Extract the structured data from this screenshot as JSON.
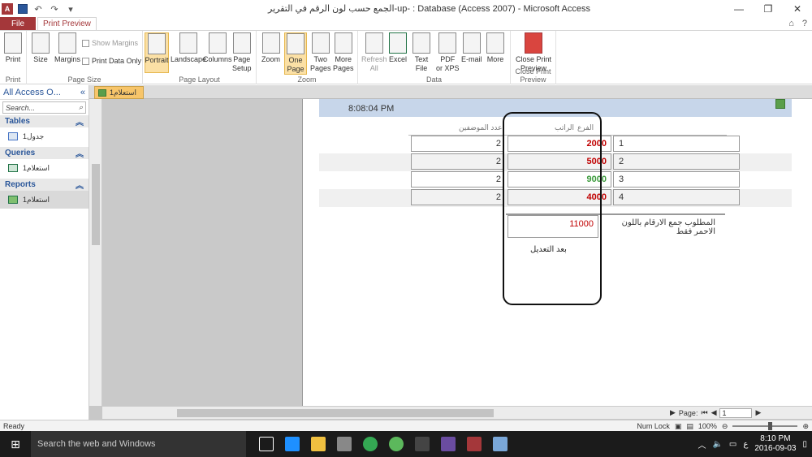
{
  "window": {
    "title": "الجمع حسب لون الرقم في التقرير-up- : Database (Access 2007) - Microsoft Access",
    "app_letter": "A",
    "help": "?"
  },
  "ribbon_tabs": {
    "file": "File",
    "active": "Print Preview"
  },
  "ribbon": {
    "groups": {
      "print": "Print",
      "page_size": "Page Size",
      "page_layout": "Page Layout",
      "zoom": "Zoom",
      "data": "Data",
      "close": "Close Print Preview"
    },
    "buttons": {
      "print": "Print",
      "size": "Size",
      "margins": "Margins",
      "show_margins": "Show Margins",
      "print_data_only": "Print Data Only",
      "portrait": "Portrait",
      "landscape": "Landscape",
      "columns": "Columns",
      "page_setup_1": "Page",
      "page_setup_2": "Setup",
      "zoom": "Zoom",
      "one_page_1": "One",
      "one_page_2": "Page",
      "two_pages_1": "Two",
      "two_pages_2": "Pages",
      "more_pages_1": "More",
      "more_pages_2": "Pages",
      "refresh_1": "Refresh",
      "refresh_2": "All",
      "excel": "Excel",
      "text_file_1": "Text",
      "text_file_2": "File",
      "pdf_1": "PDF",
      "pdf_2": "or XPS",
      "email": "E-mail",
      "more_1": "More",
      "close_1": "Close Print",
      "close_2": "Preview"
    }
  },
  "nav": {
    "header": "All Access O...",
    "search_placeholder": "Search...",
    "sections": [
      {
        "title": "Tables",
        "item": "جدول1"
      },
      {
        "title": "Queries",
        "item": "استعلام1"
      },
      {
        "title": "Reports",
        "item": "استعلام1"
      }
    ]
  },
  "doc_tab": {
    "label": "استعلام1"
  },
  "report": {
    "time": "8:08:04 PM",
    "headers": {
      "branch": "الفرع",
      "salary": "الراتب",
      "employees": "عدد الموضفين"
    },
    "rows": [
      {
        "branch": "1",
        "salary": "2000",
        "salary_color": "#c00000",
        "employees": "2"
      },
      {
        "branch": "2",
        "salary": "5000",
        "salary_color": "#c00000",
        "employees": "2"
      },
      {
        "branch": "3",
        "salary": "9000",
        "salary_color": "#3a9a3a",
        "employees": "2"
      },
      {
        "branch": "4",
        "salary": "4000",
        "salary_color": "#c00000",
        "employees": "2"
      }
    ],
    "sum_value": "11000",
    "sum_label": "المطلوب جمع الارقام باللون الاحمر فقط",
    "after_edit": "بعد التعديل"
  },
  "pager": {
    "label": "Page:",
    "value": "1"
  },
  "status": {
    "ready": "Ready",
    "num_lock": "Num Lock",
    "zoom": "100%"
  },
  "taskbar": {
    "search": "Search the web and Windows",
    "time": "8:10 PM",
    "date": "2016-09-03",
    "lang": "ع"
  }
}
